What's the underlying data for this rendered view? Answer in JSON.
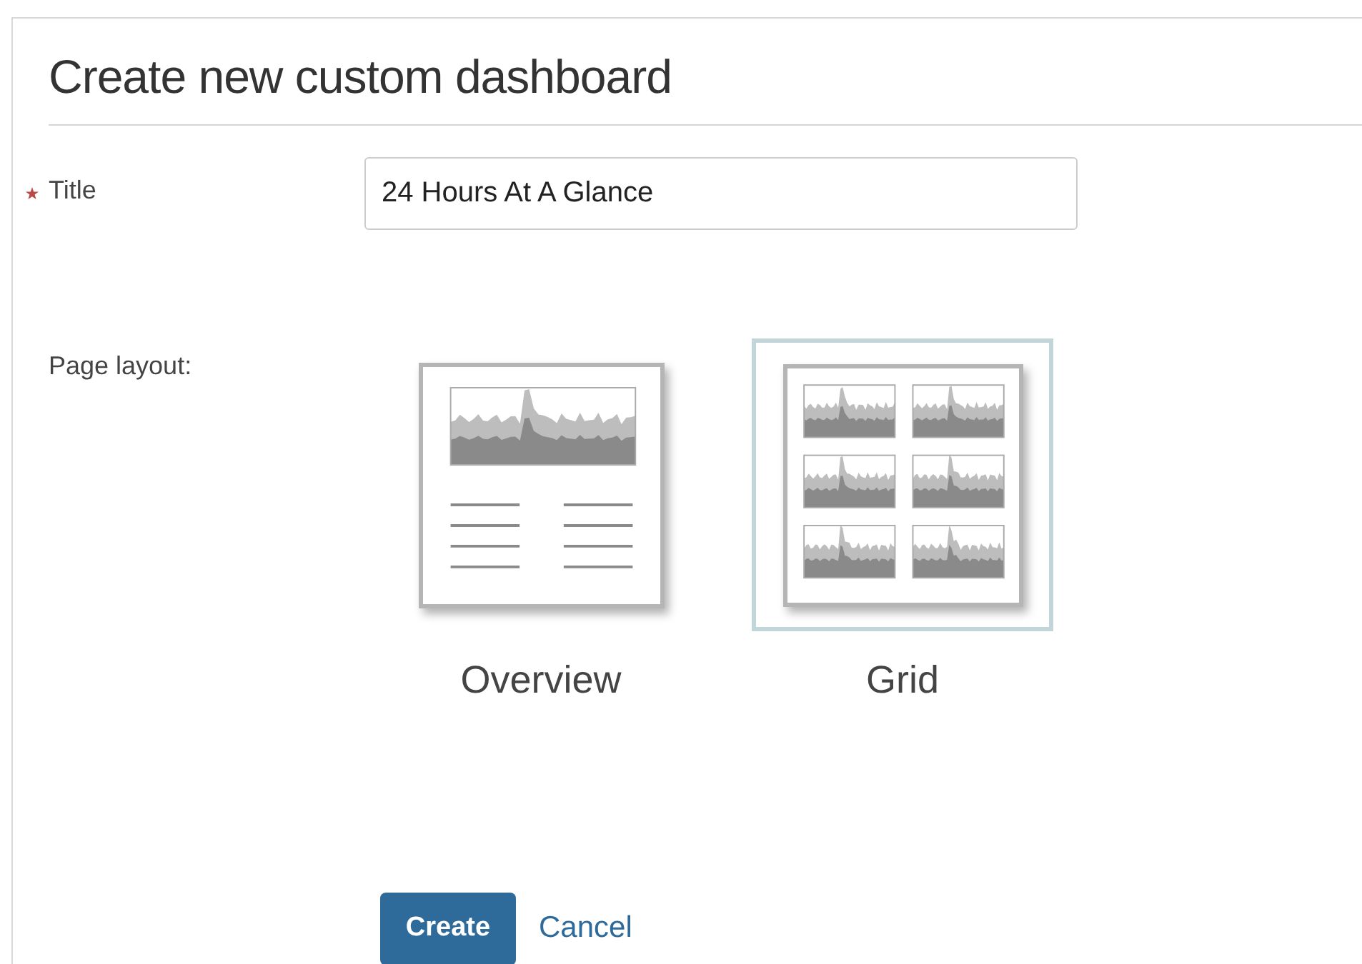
{
  "heading": "Create new custom dashboard",
  "title_field": {
    "label": "Title",
    "required": true,
    "value": "24 Hours At A Glance"
  },
  "page_layout": {
    "label": "Page layout:",
    "options": [
      {
        "kind": "overview",
        "label": "Overview",
        "selected": false
      },
      {
        "kind": "grid",
        "label": "Grid",
        "selected": true
      }
    ]
  },
  "buttons": [
    {
      "kind": "primary",
      "label": "Create"
    },
    {
      "kind": "link",
      "label": "Cancel"
    }
  ]
}
